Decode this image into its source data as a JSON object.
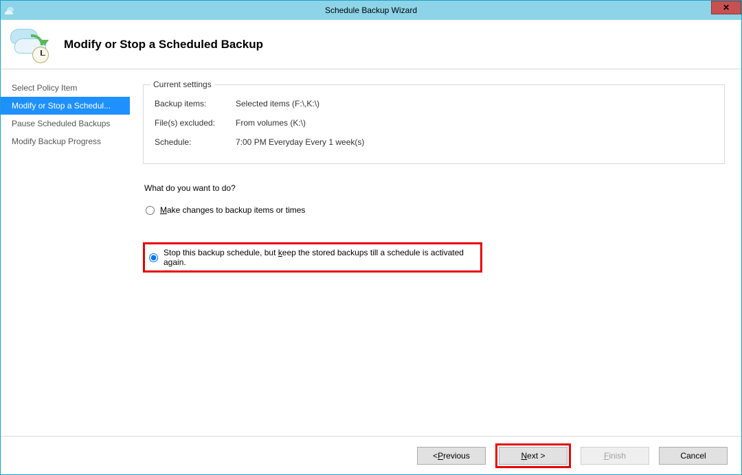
{
  "window": {
    "title": "Schedule Backup Wizard"
  },
  "header": {
    "title": "Modify or Stop a Scheduled Backup"
  },
  "sidebar": {
    "items": [
      {
        "label": "Select Policy Item",
        "active": false
      },
      {
        "label": "Modify or Stop a Schedul...",
        "active": true
      },
      {
        "label": "Pause Scheduled Backups",
        "active": false
      },
      {
        "label": "Modify Backup Progress",
        "active": false
      }
    ]
  },
  "content": {
    "fieldset_legend": "Current settings",
    "settings": [
      {
        "label": "Backup items:",
        "value": "Selected items (F:\\,K:\\)"
      },
      {
        "label": "File(s) excluded:",
        "value": "From volumes (K:\\)"
      },
      {
        "label": "Schedule:",
        "value": "7:00 PM Everyday Every 1 week(s)"
      }
    ],
    "question": "What do you want to do?",
    "options": [
      {
        "text_pre": "",
        "mnemonic": "M",
        "text_post": "ake changes to backup items or times",
        "selected": false,
        "highlighted": false
      },
      {
        "text_pre": "Stop this backup schedule, but ",
        "mnemonic": "k",
        "text_post": "eep the stored backups till a schedule is activated again.",
        "selected": true,
        "highlighted": true
      }
    ]
  },
  "footer": {
    "buttons": {
      "previous": {
        "pre": "< ",
        "mnemonic": "P",
        "post": "revious",
        "enabled": true,
        "highlighted": false
      },
      "next": {
        "pre": "",
        "mnemonic": "N",
        "post": "ext >",
        "enabled": true,
        "highlighted": true
      },
      "finish": {
        "pre": "",
        "mnemonic": "F",
        "post": "inish",
        "enabled": false,
        "highlighted": false
      },
      "cancel": {
        "pre": "Cancel",
        "mnemonic": "",
        "post": "",
        "enabled": true,
        "highlighted": false
      }
    }
  }
}
